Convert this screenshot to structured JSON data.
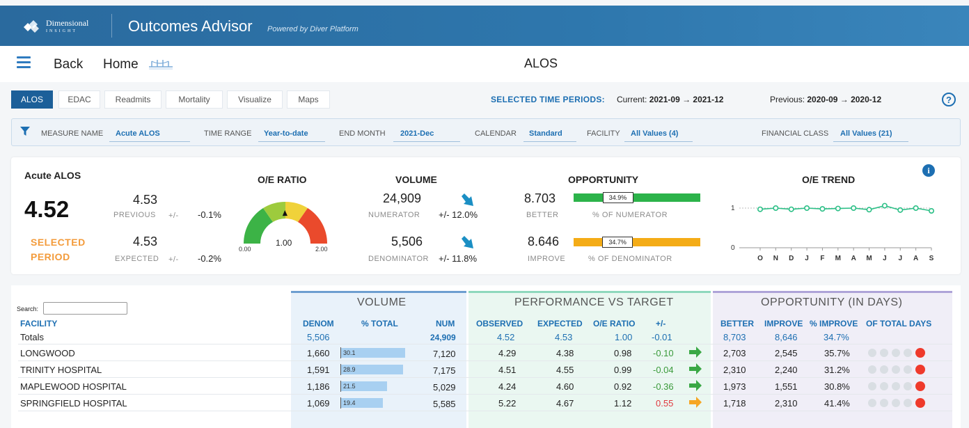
{
  "header": {
    "logo_line1": "Dimensional",
    "logo_line2": "INSIGHT",
    "app_title": "Outcomes Advisor",
    "app_subtitle": "Powered by Diver Platform"
  },
  "nav": {
    "back": "Back",
    "home": "Home",
    "page_title": "ALOS"
  },
  "tabs": [
    "ALOS",
    "EDAC",
    "Readmits",
    "Mortality",
    "Visualize",
    "Maps"
  ],
  "periods": {
    "label": "SELECTED TIME PERIODS:",
    "current_label": "Current:",
    "current_value": "2021-09 → 2021-12",
    "previous_label": "Previous:",
    "previous_value": "2020-09 → 2020-12"
  },
  "filters": {
    "measure_name_label": "MEASURE NAME",
    "measure_name": "Acute ALOS",
    "time_range_label": "TIME RANGE",
    "time_range": "Year-to-date",
    "end_month_label": "END MONTH",
    "end_month": "2021-Dec",
    "calendar_label": "CALENDAR",
    "calendar": "Standard",
    "facility_label": "FACILITY",
    "facility": "All Values (4)",
    "financial_class_label": "FINANCIAL CLASS",
    "financial_class": "All Values (21)"
  },
  "summary": {
    "title": "Acute ALOS",
    "selected_value": "4.52",
    "selected_label_1": "SELECTED",
    "selected_label_2": "PERIOD",
    "previous_value": "4.53",
    "previous_label": "PREVIOUS",
    "previous_pm": "+/-",
    "previous_change": "-0.1%",
    "expected_value": "4.53",
    "expected_label": "EXPECTED",
    "expected_pm": "+/-",
    "expected_change": "-0.2%",
    "oe_title": "O/E RATIO",
    "oe_min": "0.00",
    "oe_mid": "1.00",
    "oe_max": "2.00",
    "oe_value": 0.99,
    "volume_title": "VOLUME",
    "numerator_value": "24,909",
    "numerator_label": "NUMERATOR",
    "numerator_change": "+/- 12.0%",
    "denominator_value": "5,506",
    "denominator_label": "DENOMINATOR",
    "denominator_change": "+/- 11.8%",
    "opp_title": "OPPORTUNITY",
    "better_value": "8.703",
    "better_label": "BETTER",
    "better_pct": "34.9%",
    "better_pct_label": "% OF NUMERATOR",
    "improve_value": "8.646",
    "improve_label": "IMPROVE",
    "improve_pct": "34.7%",
    "improve_pct_label": "% OF DENOMINATOR",
    "trend_title": "O/E TREND",
    "trend_y_top": "1",
    "trend_y_bottom": "0",
    "trend_months": [
      "O",
      "N",
      "D",
      "J",
      "F",
      "M",
      "A",
      "M",
      "J",
      "J",
      "A",
      "S"
    ],
    "trend_values": [
      0.97,
      1.0,
      0.97,
      1.0,
      0.98,
      0.99,
      1.0,
      0.96,
      1.06,
      0.95,
      1.0,
      0.93
    ]
  },
  "table": {
    "search_label": "Search:",
    "facility_header": "FACILITY",
    "volume_title": "VOLUME",
    "perf_title": "PERFORMANCE VS TARGET",
    "opp_title": "OPPORTUNITY (IN DAYS)",
    "col_denom": "DENOM",
    "col_pct_total": "% TOTAL",
    "col_num": "NUM",
    "col_observed": "OBSERVED",
    "col_expected": "EXPECTED",
    "col_oe": "O/E RATIO",
    "col_pm": "+/-",
    "col_better": "BETTER",
    "col_improve": "IMPROVE",
    "col_pct_improve": "% IMPROVE",
    "col_total_days": "OF TOTAL DAYS",
    "totals": {
      "facility": "Totals",
      "denom": "5,506",
      "num": "24,909",
      "observed": "4.52",
      "expected": "4.53",
      "oe": "1.00",
      "pm": "-0.01",
      "better": "8,703",
      "improve": "8,646",
      "pct_improve": "34.7%"
    },
    "rows": [
      {
        "facility": "LONGWOOD",
        "denom": "1,660",
        "pct_total": "30.1",
        "num": "7,120",
        "observed": "4.29",
        "expected": "4.38",
        "oe": "0.98",
        "pm": "-0.10",
        "trend": "better",
        "better": "2,703",
        "improve": "2,545",
        "pct_improve": "35.7%"
      },
      {
        "facility": "TRINITY HOSPITAL",
        "denom": "1,591",
        "pct_total": "28.9",
        "num": "7,175",
        "observed": "4.51",
        "expected": "4.55",
        "oe": "0.99",
        "pm": "-0.04",
        "trend": "better",
        "better": "2,310",
        "improve": "2,240",
        "pct_improve": "31.2%"
      },
      {
        "facility": "MAPLEWOOD HOSPITAL",
        "denom": "1,186",
        "pct_total": "21.5",
        "num": "5,029",
        "observed": "4.24",
        "expected": "4.60",
        "oe": "0.92",
        "pm": "-0.36",
        "trend": "better",
        "better": "1,973",
        "improve": "1,551",
        "pct_improve": "30.8%"
      },
      {
        "facility": "SPRINGFIELD HOSPITAL",
        "denom": "1,069",
        "pct_total": "19.4",
        "num": "5,585",
        "observed": "5.22",
        "expected": "4.67",
        "oe": "1.12",
        "pm": "0.55",
        "trend": "worse",
        "better": "1,718",
        "improve": "2,310",
        "pct_improve": "41.4%"
      }
    ]
  },
  "colors": {
    "header_blue": "#2e77ad",
    "accent_blue": "#1d6fb2",
    "green": "#3a9a3a",
    "red": "#e0393e",
    "orange": "#f39b3b",
    "opp_green_bar": "#2cb34a",
    "opp_orange_bar": "#f4ac17"
  }
}
